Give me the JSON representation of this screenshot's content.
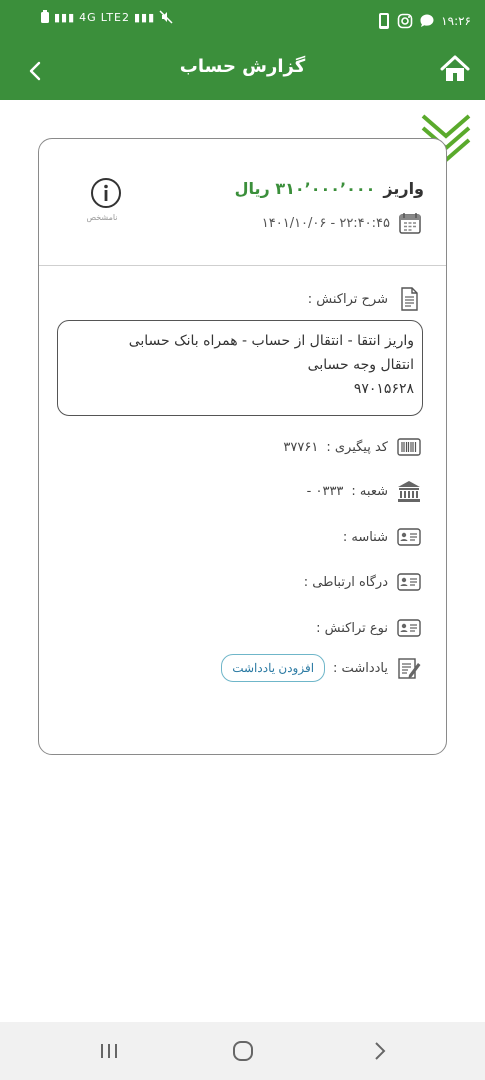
{
  "status_bar": {
    "time": "۱۹:۲۶",
    "network_left": "4G",
    "network_right": "LTE2",
    "signal_text": "Vo)"
  },
  "app_bar": {
    "title": "گزارش حساب"
  },
  "transaction": {
    "type_label": "واریز",
    "amount": "۳۱۰٬۰۰۰٬۰۰۰ ریال",
    "datetime": "۱۴۰۱/۱۰/۰۶ - ۲۲:۴۰:۴۵",
    "info_caption": "نامشخص"
  },
  "details": {
    "description_label": "شرح تراکنش :",
    "description_lines": [
      "واریز انتقا - انتقال از حساب - همراه بانک حسابی",
      "انتقال وجه حسابی",
      "۹۷۰۱۵۶۲۸"
    ],
    "tracking_label": "کد پیگیری :",
    "tracking_value": "۳۷۷۶۱",
    "branch_label": "شعبه :",
    "branch_value": "۰۳۳۳ -",
    "id_label": "شناسه :",
    "gateway_label": "درگاه ارتباطی :",
    "type_label": "نوع تراکنش :",
    "note_label": "یادداشت :",
    "add_note_button": "افزودن یادداشت"
  },
  "colors": {
    "primary": "#3b8f3b",
    "accent_blue": "#2b7aa3"
  }
}
